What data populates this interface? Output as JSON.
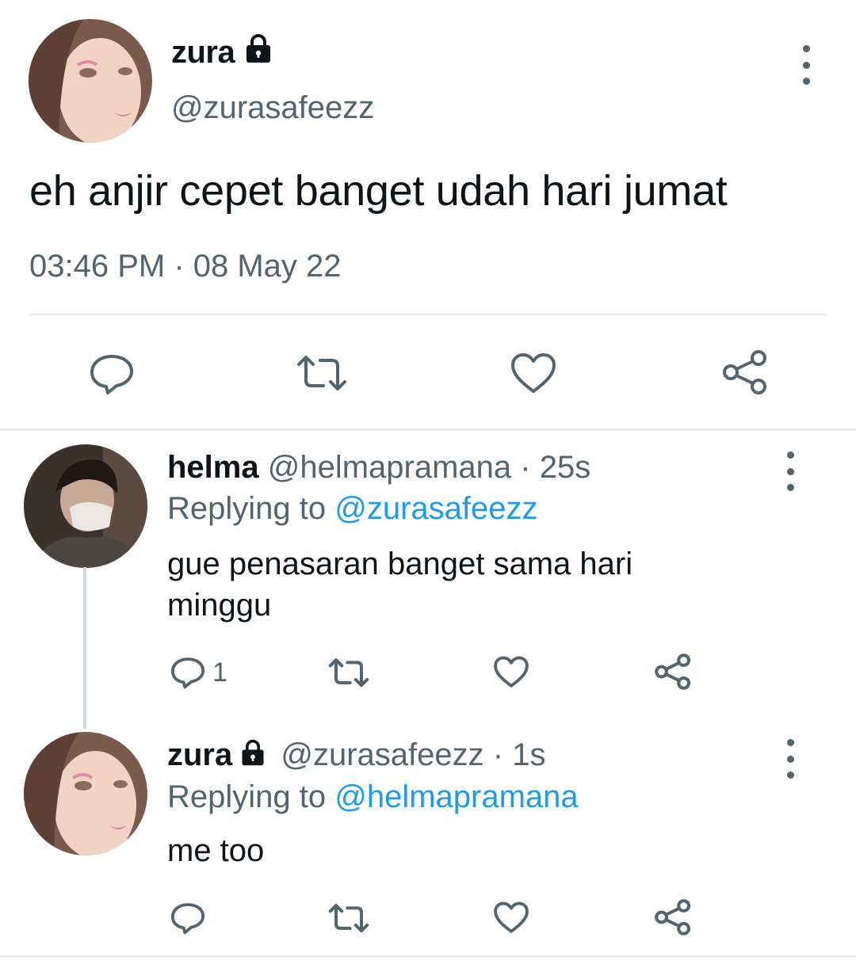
{
  "main_tweet": {
    "name": "zura",
    "handle": "@zurasafeezz",
    "text": "eh anjir cepet banget udah hari jumat",
    "timestamp": "03:46 PM · 08 May 22",
    "actions": [
      "reply-icon",
      "retweet-icon",
      "like-icon",
      "share-icon"
    ]
  },
  "replies": [
    {
      "name": "helma",
      "handle": "@helmapramana",
      "time": "· 25s",
      "replying_prefix": "Replying to",
      "replying_to": "@zurasafeezz",
      "text": "gue penasaran banget sama hari minggu",
      "reply_count": "1"
    },
    {
      "name": "zura",
      "handle": "@zurasafeezz",
      "time": "· 1s",
      "replying_prefix": "Replying to",
      "replying_to": "@helmapramana",
      "text": "me too",
      "reply_count": ""
    }
  ],
  "colors": {
    "text": "#0f1419",
    "secondary": "#536471",
    "link": "#1d9bf0",
    "divider": "#e6ecf0"
  }
}
